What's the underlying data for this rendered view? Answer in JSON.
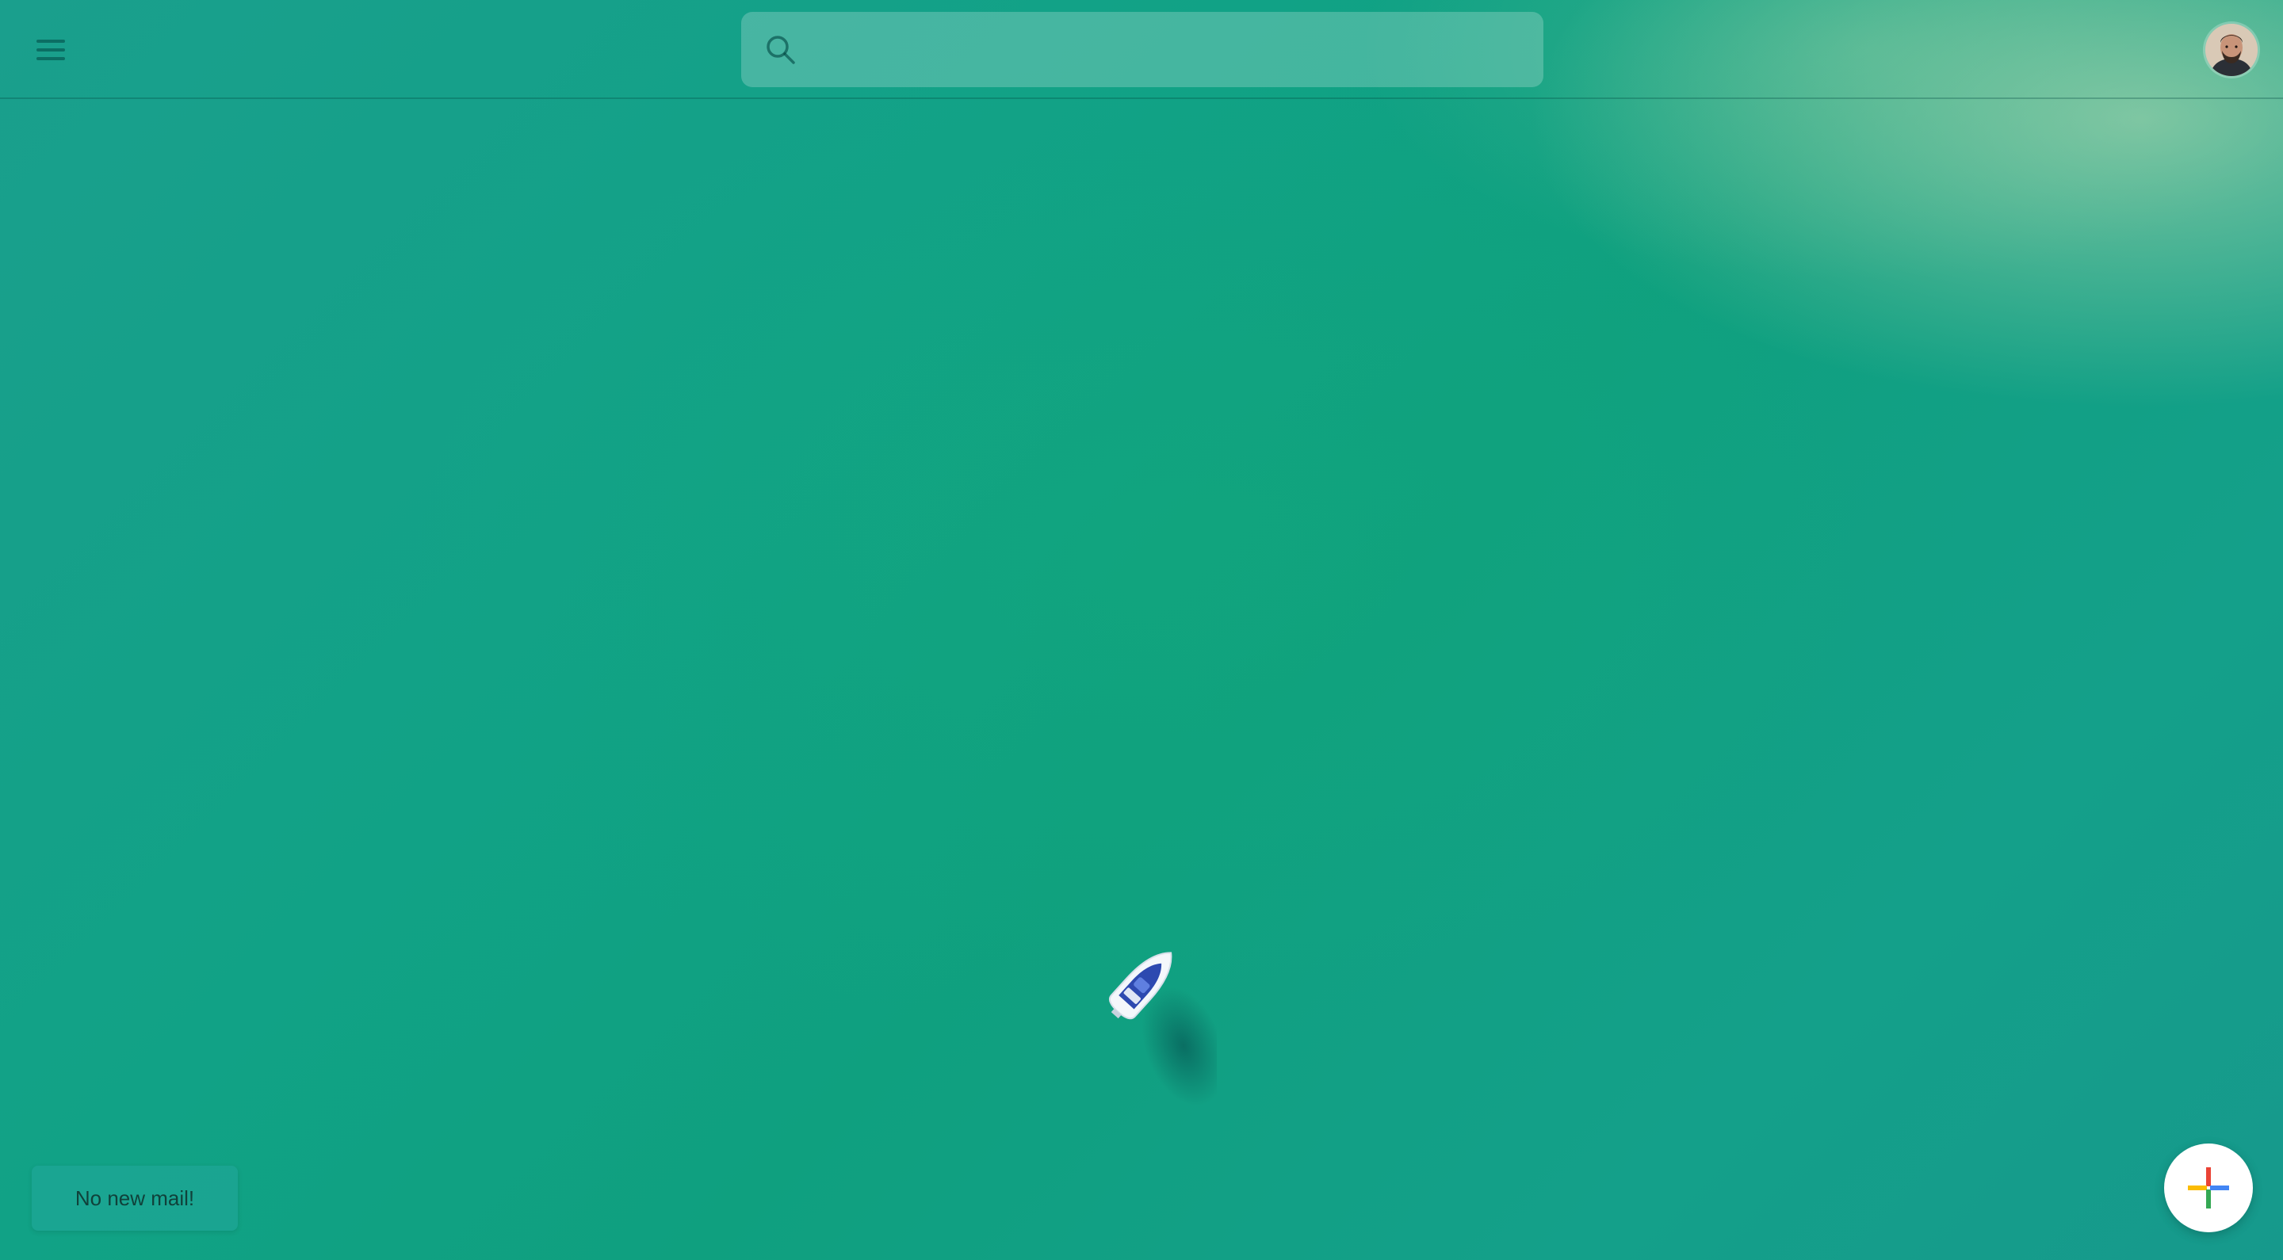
{
  "header": {
    "menu_icon": "hamburger-menu-icon",
    "search": {
      "icon": "search-icon",
      "placeholder": "",
      "value": ""
    },
    "avatar_icon": "user-avatar"
  },
  "background": {
    "description_icon": "aerial-sea-boat-wallpaper"
  },
  "toast": {
    "message": "No new mail!"
  },
  "fab": {
    "icon": "plus-icon",
    "colors": [
      "#ea4335",
      "#fbbc04",
      "#34a853",
      "#4285f4"
    ]
  }
}
